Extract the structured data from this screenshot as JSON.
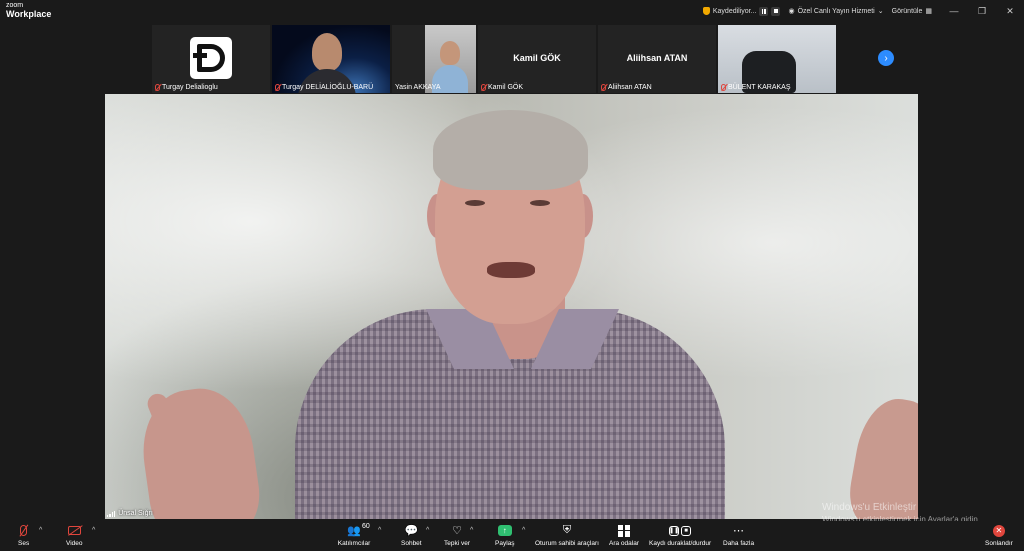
{
  "app": {
    "logo_small": "zoom",
    "logo_main": "Workplace"
  },
  "titlebar": {
    "recording_label": "Kaydediliyor...",
    "livestream_label": "Özel Canlı Yayın Hizmeti",
    "view_label": "Görüntüle",
    "accent_color": "#2d8cff"
  },
  "participants": [
    {
      "name": "Turgay Delialioglu",
      "type": "logo"
    },
    {
      "name": "Turgay DELİALİOĞLU-BARÜ",
      "type": "video"
    },
    {
      "name": "Yasin AKKAYA",
      "type": "video"
    },
    {
      "name": "Kamil GÖK",
      "type": "name",
      "big_name": "Kamil GÖK"
    },
    {
      "name": "Aliihsan ATAN",
      "type": "name",
      "big_name": "Aliihsan ATAN"
    },
    {
      "name": "BÜLENT KARAKAŞ",
      "type": "video"
    }
  ],
  "main_speaker": {
    "name": "Ünsal Sığrı"
  },
  "watermark": {
    "line1": "Windows'u Etkinleştir",
    "line2": "Windows'u etkinleştirmek için Ayarlar'a gidin."
  },
  "toolbar": {
    "audio": "Ses",
    "video": "Video",
    "participants": "Katılımcılar",
    "participants_count": "60",
    "chat": "Sohbet",
    "react": "Tepki ver",
    "share": "Paylaş",
    "host_tools": "Oturum sahibi araçları",
    "breakout": "Ara odalar",
    "record": "Kaydı duraklat/durdur",
    "more": "Daha fazla",
    "end": "Sonlandır"
  }
}
